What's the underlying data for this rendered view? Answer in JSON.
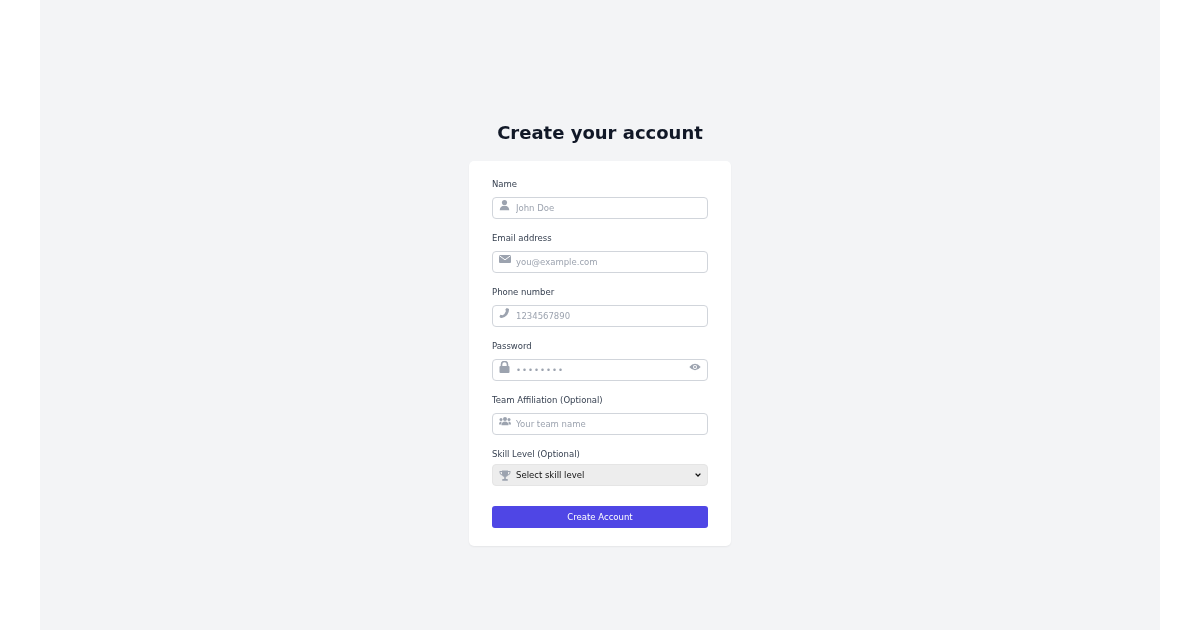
{
  "heading": "Create your account",
  "fields": [
    {
      "kind": "text",
      "label": "Name",
      "placeholder": "John Doe"
    },
    {
      "kind": "text",
      "label": "Email address",
      "placeholder": "you@example.com"
    },
    {
      "kind": "text",
      "label": "Phone number",
      "placeholder": "1234567890"
    },
    {
      "kind": "password",
      "label": "Password",
      "placeholder": "••••••••"
    },
    {
      "kind": "text",
      "label": "Team Affiliation (Optional)",
      "placeholder": "Your team name"
    },
    {
      "kind": "select",
      "label": "Skill Level (Optional)",
      "value": "Select skill level"
    }
  ],
  "submit": "Create Account"
}
